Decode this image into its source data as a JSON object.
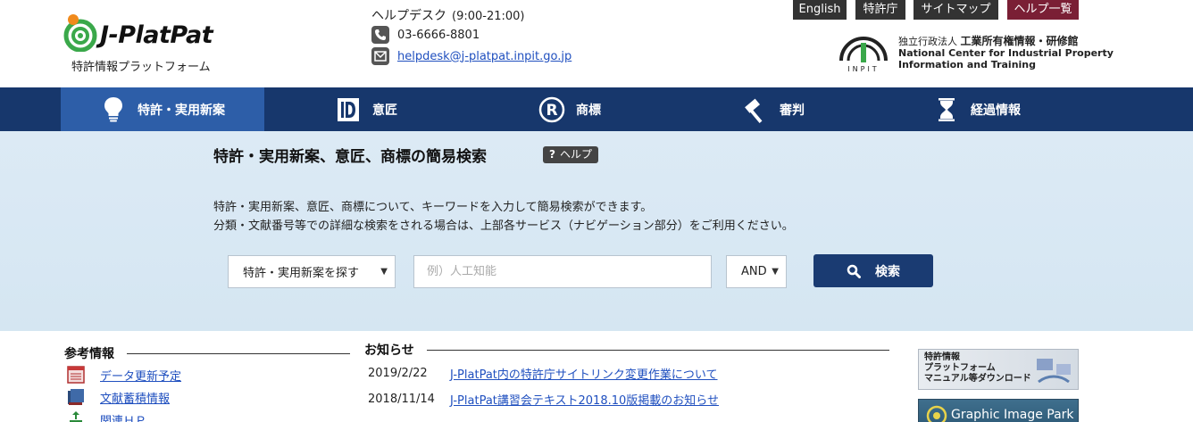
{
  "header": {
    "logo_text": "J-PlatPat",
    "logo_subtitle": "特許情報プラットフォーム",
    "helpdesk": {
      "title": "ヘルプデスク",
      "hours": "(9:00-21:00)",
      "phone": "03-6666-8801",
      "email": "helpdesk@j-platpat.inpit.go.jp"
    },
    "top_links": [
      {
        "label": "English"
      },
      {
        "label": "特許庁"
      },
      {
        "label": "サイトマップ"
      },
      {
        "label": "ヘルプ一覧"
      }
    ],
    "inpit": {
      "mark_text": "INPIT",
      "name_jp_prefix": "独立行政法人",
      "name_jp": "工業所有権情報・研修館",
      "name_en_1": "National Center for Industrial Property",
      "name_en_2": "Information and Training"
    }
  },
  "nav": {
    "items": [
      {
        "label": "特許・実用新案",
        "icon": "lightbulb-icon",
        "active": true
      },
      {
        "label": "意匠",
        "icon": "design-d-icon",
        "active": false
      },
      {
        "label": "商標",
        "icon": "registered-r-icon",
        "active": false
      },
      {
        "label": "審判",
        "icon": "gavel-icon",
        "active": false
      },
      {
        "label": "経過情報",
        "icon": "hourglass-icon",
        "active": false
      }
    ]
  },
  "search": {
    "title": "特許・実用新案、意匠、商標の簡易検索",
    "help_label": "ヘルプ",
    "help_mark": "?",
    "desc_line1": "特許・実用新案、意匠、商標について、キーワードを入力して簡易検索ができます。",
    "desc_line2": "分類・文献番号等での詳細な検索をされる場合は、上部各サービス（ナビゲーション部分）をご利用ください。",
    "category_selected": "特許・実用新案を探す",
    "keyword_placeholder": "例）人工知能",
    "keyword_value": "",
    "operator_selected": "AND",
    "button_label": "検索"
  },
  "reference": {
    "title": "参考情報",
    "items": [
      {
        "label": "データ更新予定",
        "icon": "calendar-icon"
      },
      {
        "label": "文献蓄積情報",
        "icon": "books-icon"
      },
      {
        "label": "関連ＨＰ",
        "icon": "related-link-icon"
      }
    ]
  },
  "news": {
    "title": "お知らせ",
    "items": [
      {
        "date": "2019/2/22",
        "title": "J-PlatPat内の特許庁サイトリンク変更作業について"
      },
      {
        "date": "2018/11/14",
        "title": "J-PlatPat講習会テキスト2018.10版掲載のお知らせ"
      }
    ]
  },
  "banners": {
    "manual_line1": "特許情報",
    "manual_line2": "プラットフォーム",
    "manual_line3": "マニュアル等ダウンロード",
    "graphic_image_park": "Graphic Image Park"
  },
  "colors": {
    "nav_bg": "#17376c",
    "nav_active": "#2d5ea8",
    "band_bg": "#dceaf5",
    "link": "#1f4fbf",
    "help_list_bg": "#7a1f35",
    "logo_green": "#3aa84a",
    "logo_orange": "#f08a1c"
  }
}
